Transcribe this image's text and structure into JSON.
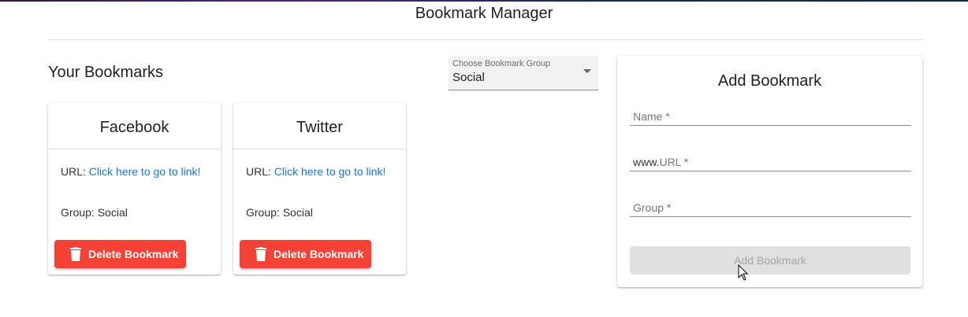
{
  "app": {
    "title": "Bookmark Manager"
  },
  "bookmarks_section": {
    "title": "Your Bookmarks"
  },
  "group_select": {
    "label": "Choose Bookmark Group",
    "value": "Social"
  },
  "bookmarks": [
    {
      "name": "Facebook",
      "url_prefix": "URL:",
      "link_text": "Click here to go to link!",
      "group_prefix": "Group:",
      "group": "Social",
      "delete_label": "Delete Bookmark"
    },
    {
      "name": "Twitter",
      "url_prefix": "URL:",
      "link_text": "Click here to go to link!",
      "group_prefix": "Group:",
      "group": "Social",
      "delete_label": "Delete Bookmark"
    }
  ],
  "add_form": {
    "title": "Add Bookmark",
    "name_placeholder": "Name *",
    "url_prefix_text": "www.",
    "url_placeholder": "URL *",
    "group_placeholder": "Group *",
    "submit_label": "Add Bookmark",
    "submit_disabled": true
  },
  "colors": {
    "delete": "#f44336",
    "link": "#1976d2",
    "disabled_bg": "#e0e0e0"
  },
  "icons": {
    "delete": "trash-icon",
    "select": "caret-down-icon",
    "cursor": "mouse-pointer-icon"
  }
}
